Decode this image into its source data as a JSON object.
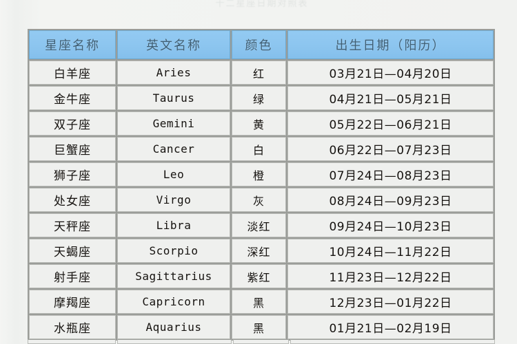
{
  "page": {
    "background_color": "#f2f3f1",
    "title_remnant": "十二星座日期对照表"
  },
  "table": {
    "header_bg_color": "#8ec7f0",
    "header_text_color": "#3e5e74",
    "cell_bg_color": "#eff0ee",
    "border_color": "#9b9d99",
    "columns": [
      {
        "key": "cn",
        "label": "星座名称"
      },
      {
        "key": "en",
        "label": "英文名称"
      },
      {
        "key": "color",
        "label": "颜色"
      },
      {
        "key": "date",
        "label": "出生日期（阳历）"
      }
    ],
    "rows": [
      {
        "cn": "白羊座",
        "en": "Aries",
        "color": "红",
        "date": "03月21日—04月20日"
      },
      {
        "cn": "金牛座",
        "en": "Taurus",
        "color": "绿",
        "date": "04月21日—05月21日"
      },
      {
        "cn": "双子座",
        "en": "Gemini",
        "color": "黄",
        "date": "05月22日—06月21日"
      },
      {
        "cn": "巨蟹座",
        "en": "Cancer",
        "color": "白",
        "date": "06月22日—07月23日"
      },
      {
        "cn": "狮子座",
        "en": "Leo",
        "color": "橙",
        "date": "07月24日—08月23日"
      },
      {
        "cn": "处女座",
        "en": "Virgo",
        "color": "灰",
        "date": "08月24日—09月23日"
      },
      {
        "cn": "天秤座",
        "en": "Libra",
        "color": "淡红",
        "date": "09月24日—10月23日"
      },
      {
        "cn": "天蝎座",
        "en": "Scorpio",
        "color": "深红",
        "date": "10月24日—11月22日"
      },
      {
        "cn": "射手座",
        "en": "Sagittarius",
        "color": "紫红",
        "date": "11月23日—12月22日"
      },
      {
        "cn": "摩羯座",
        "en": "Capricorn",
        "color": "黑",
        "date": "12月23日—01月22日"
      },
      {
        "cn": "水瓶座",
        "en": "Aquarius",
        "color": "黑",
        "date": "01月21日—02月19日"
      }
    ]
  }
}
